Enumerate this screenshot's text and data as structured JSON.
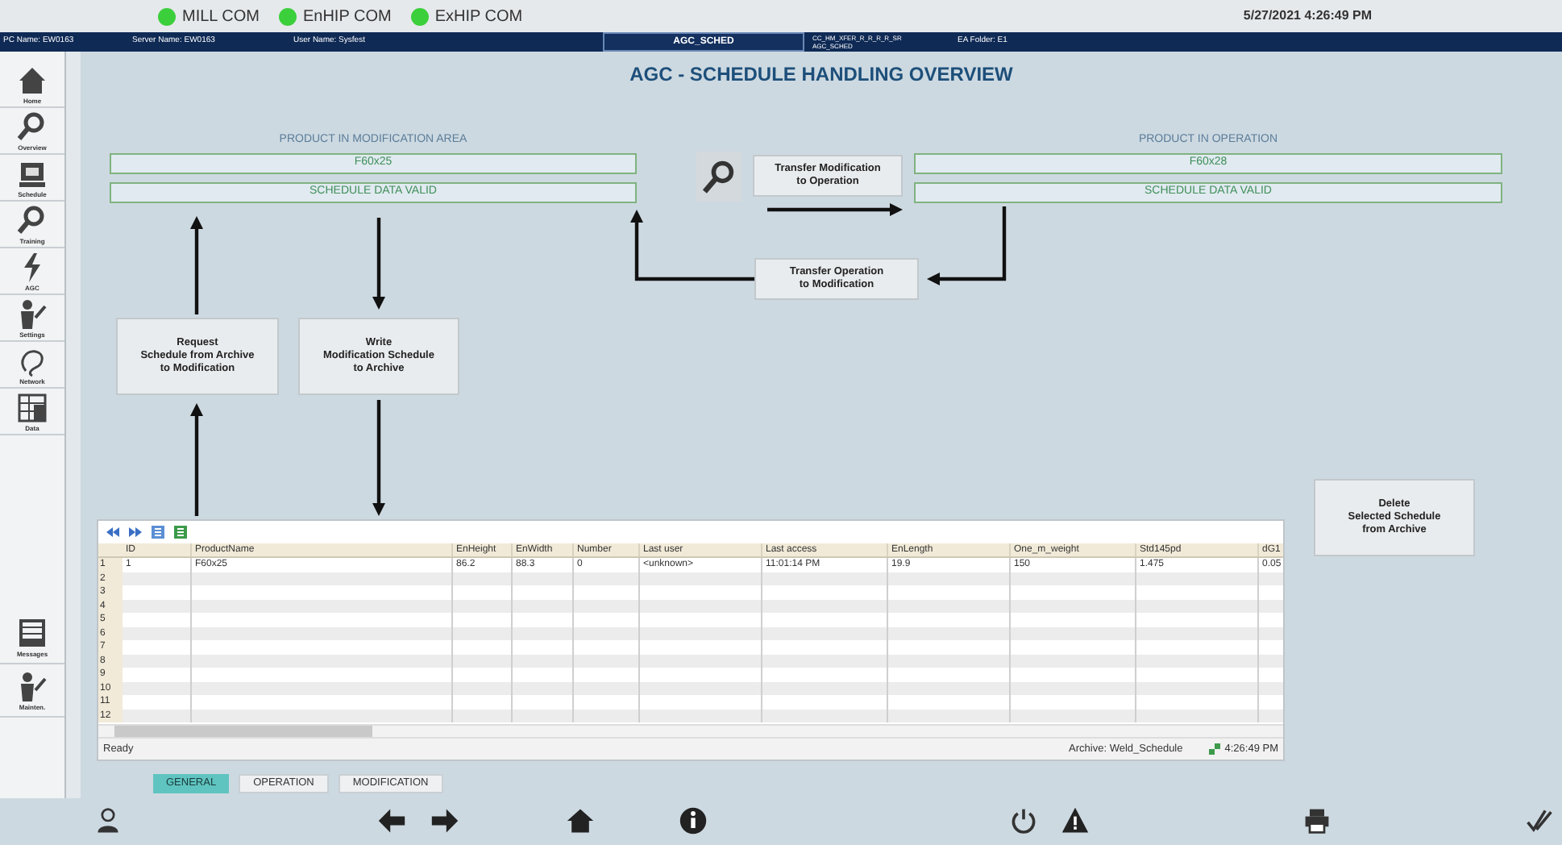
{
  "status_indicators": [
    {
      "label": "MILL COM",
      "color": "#3ccf3c"
    },
    {
      "label": "EnHIP COM",
      "color": "#3ccf3c"
    },
    {
      "label": "ExHIP COM",
      "color": "#3ccf3c"
    }
  ],
  "date_time": "5/27/2021 4:26:49 PM",
  "header_bar": {
    "pc_name": "PC Name: EW0163",
    "server_name": "Server Name: EW0163",
    "user_name": "User Name: Sysfest",
    "screen": "AGC_SCHED",
    "path_lines": [
      "CC_HM_XFER_R_R_R_R_SR",
      "AGC_SCHED"
    ],
    "folder": "EA Folder: E1"
  },
  "sidebar": {
    "items": [
      {
        "label": "Home"
      },
      {
        "label": "Overview"
      },
      {
        "label": "Schedule"
      },
      {
        "label": "Training"
      },
      {
        "label": "AGC"
      },
      {
        "label": "Settings"
      },
      {
        "label": "Network"
      },
      {
        "label": "Data"
      }
    ],
    "bottom_items": [
      {
        "label": "Messages"
      },
      {
        "label": "Mainten."
      }
    ]
  },
  "title": "AGC - SCHEDULE HANDLING OVERVIEW",
  "modification_area": {
    "heading": "PRODUCT IN MODIFICATION AREA",
    "product": "F60x25",
    "status": "SCHEDULE DATA VALID"
  },
  "operation_area": {
    "heading": "PRODUCT IN OPERATION",
    "product": "F60x28",
    "status": "SCHEDULE DATA VALID"
  },
  "actions": {
    "transfer_to_operation": "Transfer Modification\nto Operation",
    "transfer_to_modification": "Transfer Operation\nto Modification",
    "request_from_archive": "Request\nSchedule from Archive\nto Modification",
    "write_to_archive": "Write\nModification Schedule\nto Archive",
    "delete_from_archive": "Delete\nSelected Schedule\nfrom Archive"
  },
  "table": {
    "columns": [
      "ID",
      "ProductName",
      "EnHeight",
      "EnWidth",
      "Number",
      "Last user",
      "Last access",
      "EnLength",
      "One_m_weight",
      "Std145pd",
      "dG1"
    ],
    "rows": [
      {
        "number": "1",
        "cells": [
          "1",
          "F60x25",
          "86.2",
          "88.3",
          "0",
          "<unknown>",
          "11:01:14 PM",
          "19.9",
          "150",
          "1.475",
          "0.05"
        ]
      },
      {
        "number": "2",
        "cells": []
      },
      {
        "number": "3",
        "cells": []
      },
      {
        "number": "4",
        "cells": []
      },
      {
        "number": "5",
        "cells": []
      },
      {
        "number": "6",
        "cells": []
      },
      {
        "number": "7",
        "cells": []
      },
      {
        "number": "8",
        "cells": []
      },
      {
        "number": "9",
        "cells": []
      },
      {
        "number": "10",
        "cells": []
      },
      {
        "number": "11",
        "cells": []
      },
      {
        "number": "12",
        "cells": []
      }
    ]
  },
  "status_bar": {
    "state": "Ready",
    "archive": "Archive: Weld_Schedule",
    "time": "4:26:49 PM"
  },
  "tabs": [
    {
      "label": "GENERAL",
      "selected": true
    },
    {
      "label": "OPERATION",
      "selected": false
    },
    {
      "label": "MODIFICATION",
      "selected": false
    }
  ]
}
